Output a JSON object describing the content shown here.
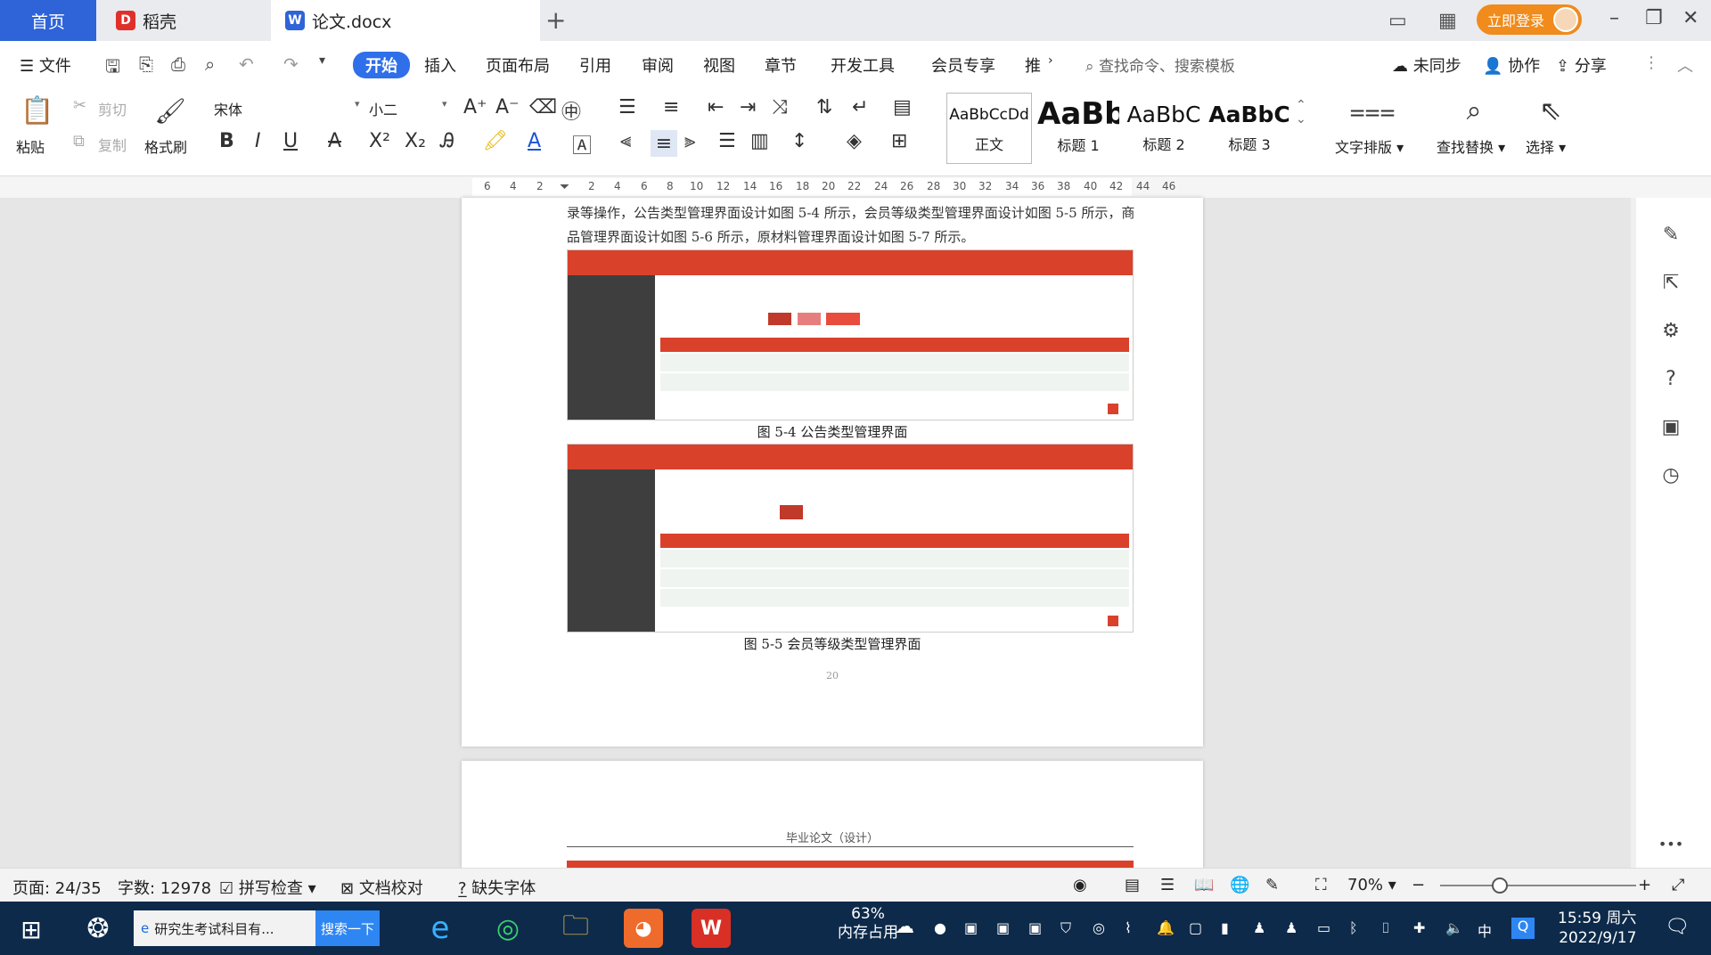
{
  "tabs": {
    "home": "首页",
    "daoke": "稻壳",
    "doc": "论文.docx",
    "new_tab": "+"
  },
  "titlebar": {
    "login": "立即登录"
  },
  "menu": {
    "file": "文件",
    "items": [
      "开始",
      "插入",
      "页面布局",
      "引用",
      "审阅",
      "视图",
      "章节",
      "开发工具",
      "会员专享",
      "推"
    ],
    "search_cmd": "查找命令、搜索模板",
    "unsync": "未同步",
    "collab": "协作",
    "share": "分享"
  },
  "ribbon": {
    "paste": "粘贴",
    "cut": "剪切",
    "copy": "复制",
    "format_painter": "格式刷",
    "font_name": "宋体",
    "font_size": "小二",
    "styles": [
      {
        "preview": "AaBbCcDd",
        "label": "正文"
      },
      {
        "preview": "AaBb",
        "label": "标题 1"
      },
      {
        "preview": "AaBbC",
        "label": "标题 2"
      },
      {
        "preview": "AaBbC",
        "label": "标题 3"
      }
    ],
    "text_layout": "文字排版",
    "find_replace": "查找替换",
    "select": "选择"
  },
  "ruler": {
    "ticks": [
      "6",
      "4",
      "2",
      "",
      "2",
      "4",
      "6",
      "8",
      "10",
      "12",
      "14",
      "16",
      "18",
      "20",
      "22",
      "24",
      "26",
      "28",
      "30",
      "32",
      "34",
      "36",
      "38",
      "40",
      "42",
      "44",
      "46"
    ]
  },
  "document": {
    "para": "录等操作，公告类型管理界面设计如图 5-4 所示，会员等级类型管理界面设计如图 5-5 所示，商品管理界面设计如图 5-6 所示，原材料管理界面设计如图 5-7 所示。",
    "fig1_caption": "图 5-4 公告类型管理界面",
    "fig2_caption": "图 5-5 会员等级类型管理界面",
    "page_footer": "20",
    "next_header": "毕业论文（设计）"
  },
  "statusbar": {
    "page": "页面: 24/35",
    "words": "字数: 12978",
    "spell": "拼写检查",
    "proof": "文档校对",
    "missing_font": "缺失字体",
    "zoom": "70%"
  },
  "taskbar": {
    "browser_tab": "研究生考试科目有...",
    "search_btn": "搜索一下",
    "mem_percent": "63%",
    "mem_label": "内存占用",
    "ime": "中",
    "time": "15:59 周六",
    "date": "2022/9/17"
  },
  "colors": {
    "accent": "#2f6fea",
    "shot_red": "#d9412b",
    "login_orange": "#f08b1c"
  }
}
